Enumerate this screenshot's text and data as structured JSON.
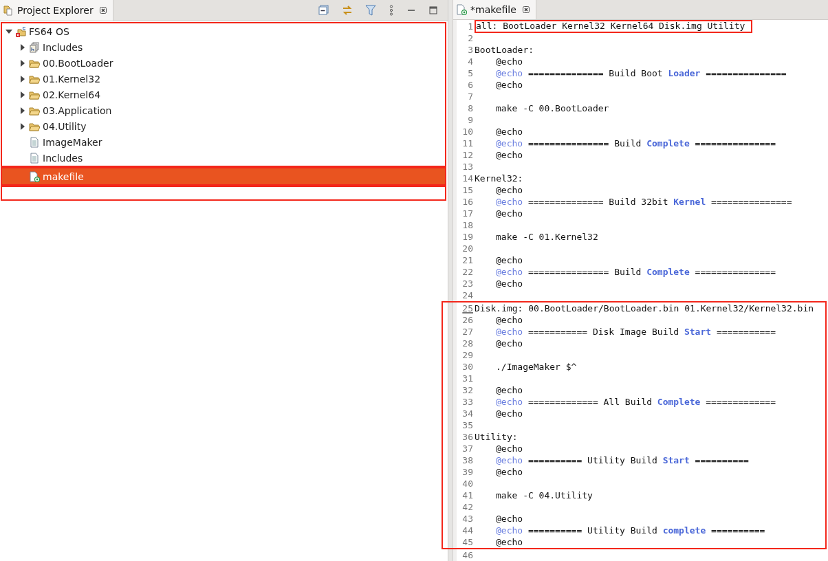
{
  "explorer": {
    "tab": {
      "label": "Project Explorer",
      "selected": true
    },
    "tree": [
      {
        "label": "FS64 OS",
        "kind": "project",
        "expanded": true,
        "selected": false,
        "framed": true,
        "frame_start": true,
        "children": [
          {
            "label": "Includes",
            "kind": "includes",
            "expanded": false,
            "selected": false,
            "framed": true
          },
          {
            "label": "00.BootLoader",
            "kind": "folder",
            "expanded": false,
            "selected": false,
            "framed": true
          },
          {
            "label": "01.Kernel32",
            "kind": "folder",
            "expanded": false,
            "selected": false,
            "framed": true
          },
          {
            "label": "02.Kernel64",
            "kind": "folder",
            "expanded": false,
            "selected": false,
            "framed": true
          },
          {
            "label": "03.Application",
            "kind": "folder",
            "expanded": false,
            "selected": false,
            "framed": true
          },
          {
            "label": "04.Utility",
            "kind": "folder",
            "expanded": false,
            "selected": false,
            "framed": true
          },
          {
            "label": "ImageMaker",
            "kind": "file",
            "selected": false,
            "framed": true
          },
          {
            "label": "Includes",
            "kind": "file",
            "selected": false,
            "framed": true
          },
          {
            "label": "makefile",
            "kind": "makefile",
            "selected": true,
            "framed": true,
            "frame_start": true
          }
        ]
      }
    ],
    "empty_frame": true
  },
  "editor": {
    "tab": {
      "label": "*makefile",
      "selected": true
    },
    "blocks": [
      {
        "kind": "framed-text",
        "lines": [
          {
            "number": "1",
            "code": [
              {
                "kind": "plain",
                "text": "all: BootLoader Kernel32 Kernel64 Disk.img Utility"
              }
            ]
          }
        ]
      },
      {
        "kind": "plain",
        "lines": [
          {
            "number": "2"
          },
          {
            "number": "3",
            "code": [
              {
                "kind": "plain",
                "text": "BootLoader:"
              }
            ]
          },
          {
            "number": "4",
            "indented": true,
            "code": [
              {
                "kind": "plain",
                "text": "@echo"
              }
            ]
          },
          {
            "number": "5",
            "indented": true,
            "code": [
              {
                "kind": "keyword",
                "text": "@echo"
              },
              {
                "kind": "plain",
                "text": " ============== Build Boot "
              },
              {
                "kind": "bold",
                "text": "Loader"
              },
              {
                "kind": "plain",
                "text": " ==============="
              }
            ]
          },
          {
            "number": "6",
            "indented": true,
            "code": [
              {
                "kind": "plain",
                "text": "@echo"
              }
            ]
          },
          {
            "number": "7"
          },
          {
            "number": "8",
            "indented": true,
            "code": [
              {
                "kind": "plain",
                "text": "make -C 00.BootLoader"
              }
            ]
          },
          {
            "number": "9"
          },
          {
            "number": "10",
            "indented": true,
            "code": [
              {
                "kind": "plain",
                "text": "@echo"
              }
            ]
          },
          {
            "number": "11",
            "indented": true,
            "code": [
              {
                "kind": "keyword",
                "text": "@echo"
              },
              {
                "kind": "plain",
                "text": " =============== Build "
              },
              {
                "kind": "bold",
                "text": "Complete"
              },
              {
                "kind": "plain",
                "text": " ==============="
              }
            ]
          },
          {
            "number": "12",
            "indented": true,
            "code": [
              {
                "kind": "plain",
                "text": "@echo"
              }
            ]
          },
          {
            "number": "13"
          },
          {
            "number": "14",
            "code": [
              {
                "kind": "plain",
                "text": "Kernel32:"
              }
            ]
          },
          {
            "number": "15",
            "indented": true,
            "code": [
              {
                "kind": "plain",
                "text": "@echo"
              }
            ]
          },
          {
            "number": "16",
            "indented": true,
            "code": [
              {
                "kind": "keyword",
                "text": "@echo"
              },
              {
                "kind": "plain",
                "text": " ============== Build 32bit "
              },
              {
                "kind": "bold",
                "text": "Kernel"
              },
              {
                "kind": "plain",
                "text": " ==============="
              }
            ]
          },
          {
            "number": "17",
            "indented": true,
            "code": [
              {
                "kind": "plain",
                "text": "@echo"
              }
            ]
          },
          {
            "number": "18"
          },
          {
            "number": "19",
            "indented": true,
            "code": [
              {
                "kind": "plain",
                "text": "make -C 01.Kernel32"
              }
            ]
          },
          {
            "number": "20"
          },
          {
            "number": "21",
            "indented": true,
            "code": [
              {
                "kind": "plain",
                "text": "@echo"
              }
            ]
          },
          {
            "number": "22",
            "indented": true,
            "code": [
              {
                "kind": "keyword",
                "text": "@echo"
              },
              {
                "kind": "plain",
                "text": " =============== Build "
              },
              {
                "kind": "bold",
                "text": "Complete"
              },
              {
                "kind": "plain",
                "text": " ==============="
              }
            ]
          },
          {
            "number": "23",
            "indented": true,
            "code": [
              {
                "kind": "plain",
                "text": "@echo"
              }
            ]
          },
          {
            "number": "24"
          }
        ]
      },
      {
        "kind": "framed-block",
        "lines": [
          {
            "number": "25",
            "current": true,
            "code": [
              {
                "kind": "plain",
                "text": "Disk.img: 00.BootLoader/BootLoader.bin 01.Kernel32/Kernel32.bin"
              }
            ]
          },
          {
            "number": "26",
            "indented": true,
            "code": [
              {
                "kind": "plain",
                "text": "@echo"
              }
            ]
          },
          {
            "number": "27",
            "indented": true,
            "code": [
              {
                "kind": "keyword",
                "text": "@echo"
              },
              {
                "kind": "plain",
                "text": " =========== Disk Image Build "
              },
              {
                "kind": "bold",
                "text": "Start"
              },
              {
                "kind": "plain",
                "text": " ==========="
              }
            ]
          },
          {
            "number": "28",
            "indented": true,
            "code": [
              {
                "kind": "plain",
                "text": "@echo"
              }
            ]
          },
          {
            "number": "29"
          },
          {
            "number": "30",
            "indented": true,
            "code": [
              {
                "kind": "plain",
                "text": "./ImageMaker $^"
              }
            ]
          },
          {
            "number": "31"
          },
          {
            "number": "32",
            "indented": true,
            "code": [
              {
                "kind": "plain",
                "text": "@echo"
              }
            ]
          },
          {
            "number": "33",
            "indented": true,
            "code": [
              {
                "kind": "keyword",
                "text": "@echo"
              },
              {
                "kind": "plain",
                "text": " ============= All Build "
              },
              {
                "kind": "bold",
                "text": "Complete"
              },
              {
                "kind": "plain",
                "text": " ============="
              }
            ]
          },
          {
            "number": "34",
            "indented": true,
            "code": [
              {
                "kind": "plain",
                "text": "@echo"
              }
            ]
          },
          {
            "number": "35"
          },
          {
            "number": "36",
            "code": [
              {
                "kind": "plain",
                "text": "Utility:"
              }
            ]
          },
          {
            "number": "37",
            "indented": true,
            "code": [
              {
                "kind": "plain",
                "text": "@echo"
              }
            ]
          },
          {
            "number": "38",
            "indented": true,
            "code": [
              {
                "kind": "keyword",
                "text": "@echo"
              },
              {
                "kind": "plain",
                "text": " ========== Utility Build "
              },
              {
                "kind": "bold",
                "text": "Start"
              },
              {
                "kind": "plain",
                "text": " =========="
              }
            ]
          },
          {
            "number": "39",
            "indented": true,
            "code": [
              {
                "kind": "plain",
                "text": "@echo"
              }
            ]
          },
          {
            "number": "40"
          },
          {
            "number": "41",
            "indented": true,
            "code": [
              {
                "kind": "plain",
                "text": "make -C 04.Utility"
              }
            ]
          },
          {
            "number": "42"
          },
          {
            "number": "43",
            "indented": true,
            "code": [
              {
                "kind": "plain",
                "text": "@echo"
              }
            ]
          },
          {
            "number": "44",
            "indented": true,
            "code": [
              {
                "kind": "keyword",
                "text": "@echo"
              },
              {
                "kind": "plain",
                "text": " ========== Utility Build "
              },
              {
                "kind": "bold",
                "text": "complete"
              },
              {
                "kind": "plain",
                "text": " =========="
              }
            ]
          },
          {
            "number": "45",
            "indented": true,
            "code": [
              {
                "kind": "plain",
                "text": "@echo"
              }
            ]
          }
        ]
      },
      {
        "kind": "plain",
        "lines": [
          {
            "number": "46"
          }
        ]
      }
    ]
  }
}
